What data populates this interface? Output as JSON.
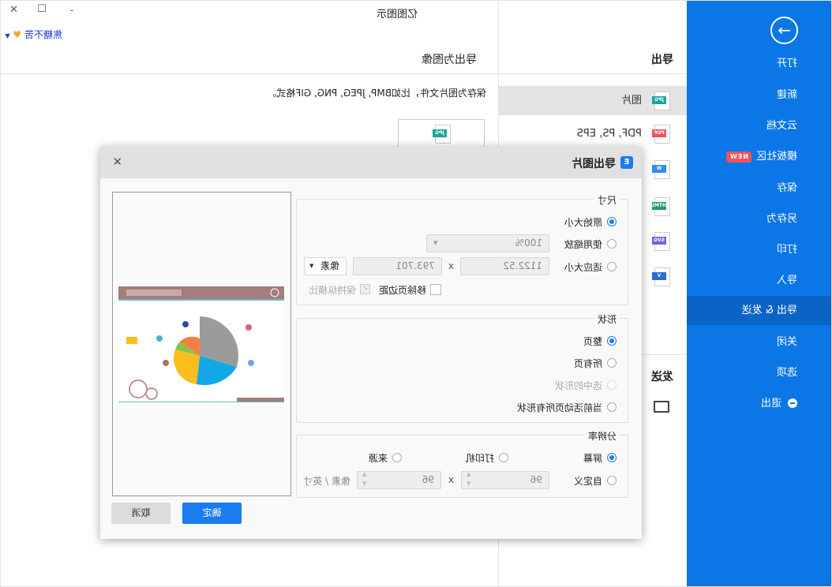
{
  "window": {
    "title": "亿图图示",
    "user": "焦糖不苦",
    "minimize": "-",
    "maximize": "☐",
    "close": "✕"
  },
  "sidebar": {
    "back_icon": "arrow-right-circle-icon",
    "items": [
      {
        "label": "打开"
      },
      {
        "label": "新建"
      },
      {
        "label": "云文档"
      },
      {
        "label": "模板社区",
        "badge": "NEW"
      },
      {
        "label": "保存"
      },
      {
        "label": "另存为"
      },
      {
        "label": "打印"
      },
      {
        "label": "导入"
      },
      {
        "label": "导出 & 发送",
        "active": true
      },
      {
        "label": "关闭"
      },
      {
        "label": "选项"
      },
      {
        "label": "退出"
      }
    ]
  },
  "middle": {
    "export_header": "导出",
    "send_header": "发送",
    "items": [
      {
        "label": "图片",
        "tag": "JPG",
        "color": "#1aa59a",
        "selected": true
      },
      {
        "label": "PDF, PS, EPS",
        "tag": "PDF",
        "color": "#f4525a"
      },
      {
        "label": "",
        "tag": "W",
        "color": "#2f8cf0"
      },
      {
        "label": "",
        "tag": "HTML",
        "color": "#1e9e6a"
      },
      {
        "label": "",
        "tag": "SVG",
        "color": "#7a5fe0"
      },
      {
        "label": "",
        "tag": "V",
        "color": "#2a6fd6"
      }
    ]
  },
  "content": {
    "header": "导出为图像",
    "description": "保存为图片文件，比如BMP, JPEG, PNG, GIF格式。",
    "thumb_tag": "JPG"
  },
  "dialog": {
    "title": "导出图片",
    "close": "✕",
    "size": {
      "legend": "尺寸",
      "original": "原始大小",
      "use_zoom": "使用缩放",
      "zoom_value": "100%",
      "fit": "适应大小",
      "width": "1122.52",
      "x": "x",
      "height": "793.701",
      "unit": "像素",
      "remove_margin": "移除页边距",
      "keep_ratio": "保持纵横比",
      "selected": "original"
    },
    "shape": {
      "legend": "形状",
      "options": [
        "整页",
        "所有页",
        "选中的形状",
        "当前活动页所有形状"
      ],
      "selected": 0
    },
    "resolution": {
      "legend": "分辨率",
      "screen": "屏幕",
      "printer": "打印机",
      "source": "来源",
      "custom": "自定义",
      "dpi_x": "96",
      "x": "x",
      "dpi_y": "96",
      "unit": "像素 / 英寸",
      "selected": "screen"
    },
    "ok": "确定",
    "cancel": "取消",
    "accent": "#1a7cf0"
  }
}
